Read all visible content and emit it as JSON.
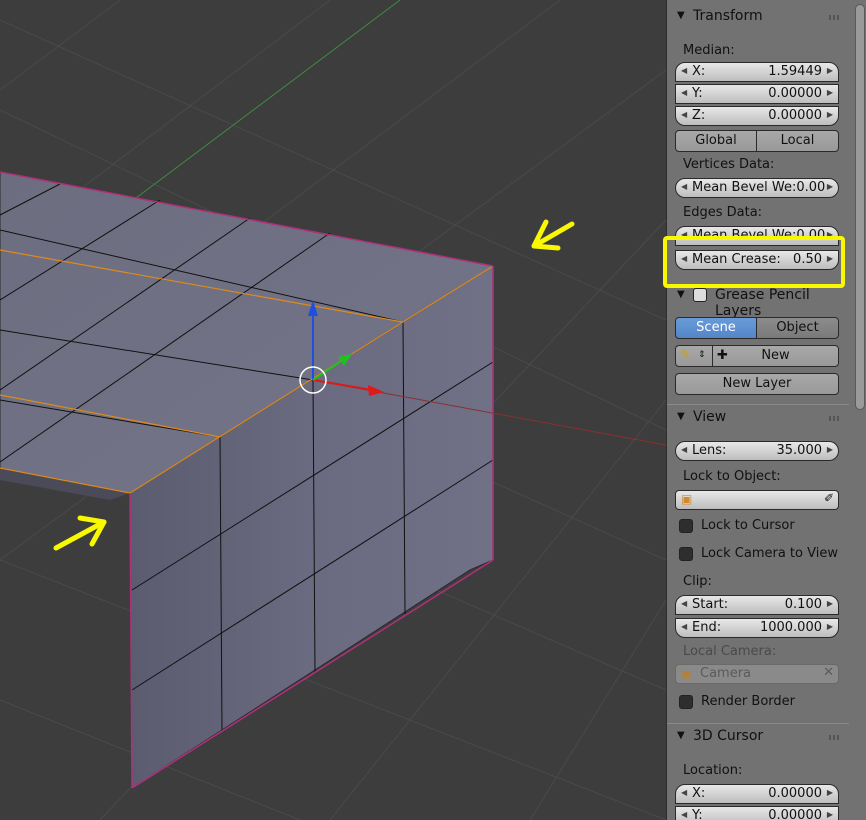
{
  "transform": {
    "title": "Transform",
    "median_label": "Median:",
    "x": {
      "key": "X:",
      "value": "1.59449"
    },
    "y": {
      "key": "Y:",
      "value": "0.00000"
    },
    "z": {
      "key": "Z:",
      "value": "0.00000"
    },
    "global_label": "Global",
    "local_label": "Local",
    "vertices_label": "Vertices Data:",
    "vert_bevel": "Mean Bevel We:0.00",
    "edges_label": "Edges Data:",
    "edge_bevel": "Mean Bevel We:0.00",
    "crease": {
      "key": "Mean Crease:",
      "value": "0.50"
    }
  },
  "grease": {
    "title": "Grease Pencil Layers",
    "scene_label": "Scene",
    "object_label": "Object",
    "new_label": "New",
    "new_layer_label": "New Layer"
  },
  "view": {
    "title": "View",
    "lens": {
      "key": "Lens:",
      "value": "35.000"
    },
    "lock_object_label": "Lock to Object:",
    "lock_cursor_label": "Lock to Cursor",
    "lock_camera_label": "Lock Camera to View",
    "clip_label": "Clip:",
    "start": {
      "key": "Start:",
      "value": "0.100"
    },
    "end": {
      "key": "End:",
      "value": "1000.000"
    },
    "local_camera_label": "Local Camera:",
    "camera_value": "Camera",
    "render_border_label": "Render Border"
  },
  "cursor": {
    "title": "3D Cursor",
    "location_label": "Location:",
    "x": {
      "key": "X:",
      "value": "0.00000"
    },
    "y": {
      "key": "Y:",
      "value": "0.00000"
    }
  },
  "colors": {
    "highlight": "#f8f800",
    "selected_button": "#5485c8",
    "mesh": "#6e6e82"
  }
}
